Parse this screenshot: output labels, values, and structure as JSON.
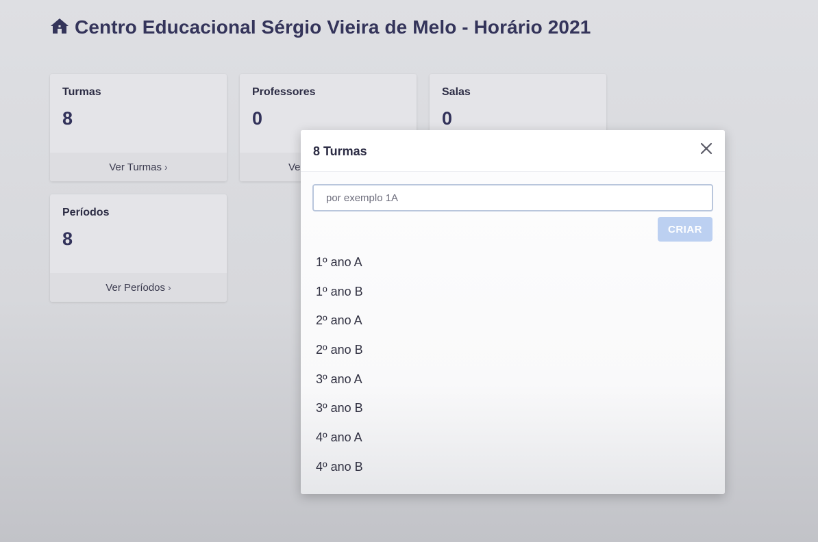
{
  "header": {
    "title": "Centro Educacional Sérgio Vieira de Melo - Horário 2021",
    "icon": "home-icon"
  },
  "cards": {
    "turmas": {
      "label": "Turmas",
      "value": "8",
      "link": "Ver Turmas"
    },
    "professores": {
      "label": "Professores",
      "value": "0",
      "link": "Ve"
    },
    "salas": {
      "label": "Salas",
      "value": "0"
    },
    "periodos": {
      "label": "Períodos",
      "value": "8",
      "link": "Ver Períodos"
    }
  },
  "modal": {
    "title": "8 Turmas",
    "search_placeholder": "por exemplo 1A",
    "search_value": "",
    "create_label": "CRIAR",
    "items": [
      "1º ano A",
      "1º ano B",
      "2º ano A",
      "2º ano B",
      "3º ano A",
      "3º ano B",
      "4º ano A",
      "4º ano B"
    ]
  },
  "colors": {
    "accent_disabled": "#bcd0f1",
    "title_color": "#34345a"
  }
}
